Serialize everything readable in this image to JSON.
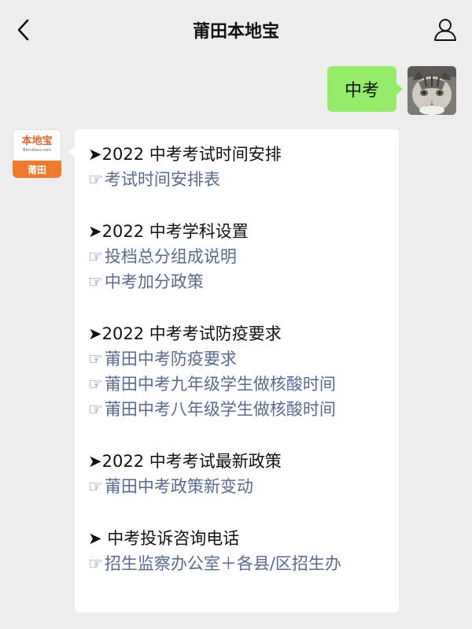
{
  "header": {
    "title": "莆田本地宝"
  },
  "outgoing": {
    "text": "中考"
  },
  "bot_avatar": {
    "logo_text": "本地宝",
    "logo_sub": "Bendibao.com",
    "band_text": "莆田"
  },
  "marker": "➤",
  "pointer": "☞",
  "sections": [
    {
      "title": "2022 中考考试时间安排",
      "links": [
        "考试时间安排表"
      ]
    },
    {
      "title": "2022 中考学科设置",
      "links": [
        "投档总分组成说明",
        "中考加分政策"
      ]
    },
    {
      "title": "2022 中考考试防疫要求",
      "links": [
        "莆田中考防疫要求",
        "莆田中考九年级学生做核酸时间",
        "莆田中考八年级学生做核酸时间"
      ]
    },
    {
      "title": "2022 中考考试最新政策",
      "links": [
        "莆田中考政策新变动"
      ]
    },
    {
      "title": " 中考投诉咨询电话",
      "links": [
        "招生监察办公室＋各县/区招生办"
      ]
    }
  ]
}
